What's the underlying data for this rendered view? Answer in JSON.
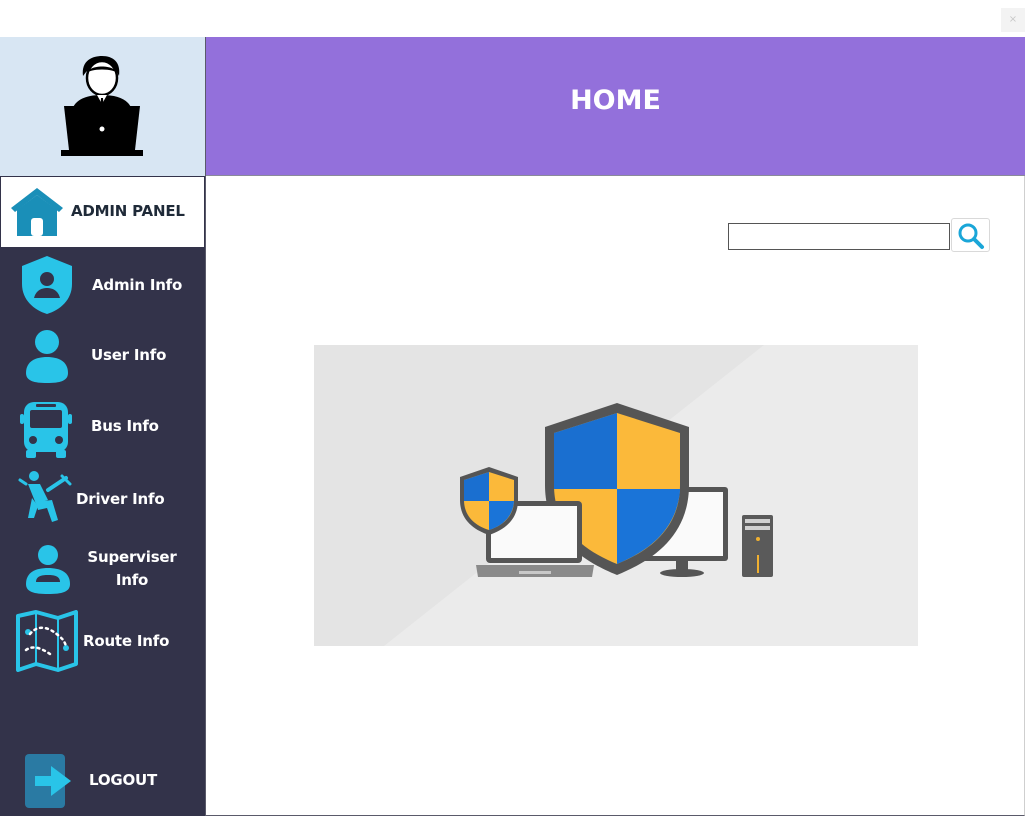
{
  "window": {
    "close_glyph": "×"
  },
  "header": {
    "title": "HOME"
  },
  "sidebar": {
    "admin_panel_label": "ADMIN PANEL",
    "items": [
      {
        "label": "Admin Info",
        "icon": "shield-user-icon"
      },
      {
        "label": "User Info",
        "icon": "user-icon"
      },
      {
        "label": "Bus Info",
        "icon": "bus-icon"
      },
      {
        "label": "Driver Info",
        "icon": "driver-icon"
      },
      {
        "label": "Superviser Info",
        "icon": "supervisor-icon"
      },
      {
        "label": "Route Info",
        "icon": "route-map-icon"
      }
    ],
    "logout_label": "LOGOUT"
  },
  "search": {
    "value": "",
    "placeholder": ""
  },
  "colors": {
    "header_bg": "#9370db",
    "sidebar_bg": "#33334a",
    "avatar_bg": "#d8e6f3",
    "icon_accent": "#29c4e8"
  }
}
